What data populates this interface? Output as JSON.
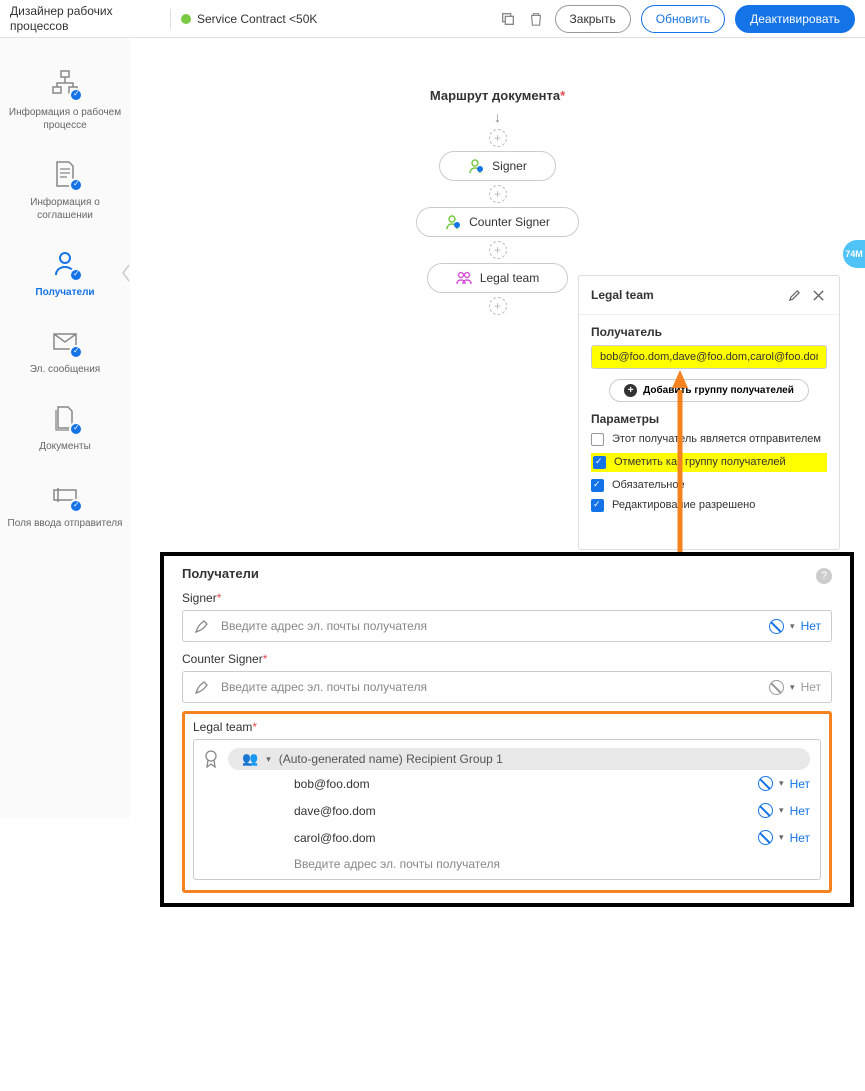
{
  "header": {
    "title": "Дизайнер рабочих процессов",
    "contractName": "Service Contract <50K",
    "closeBtn": "Закрыть",
    "refreshBtn": "Обновить",
    "deactivateBtn": "Деактивировать"
  },
  "sidebar": {
    "items": [
      {
        "label": "Информация о рабочем процессе"
      },
      {
        "label": "Информация о соглашении"
      },
      {
        "label": "Получатели"
      },
      {
        "label": "Эл. сообщения"
      },
      {
        "label": "Документы"
      },
      {
        "label": "Поля ввода отправителя"
      }
    ]
  },
  "canvas": {
    "routeTitle": "Маршрут документа",
    "nodes": [
      "Signer",
      "Counter Signer",
      "Legal team"
    ]
  },
  "panel": {
    "title": "Legal team",
    "recipientLabel": "Получатель",
    "recipientValue": "bob@foo.dom,dave@foo.dom,carol@foo.dom",
    "addGroupBtn": "Добавить группу получателей",
    "paramsLabel": "Параметры",
    "opt1": "Этот получатель является отправителем",
    "opt2": "Отметить как группу получателей",
    "opt3": "Обязательное",
    "opt4": "Редактирование разрешено"
  },
  "badge": "74M",
  "results": {
    "title": "Получатели",
    "fields": [
      {
        "label": "Signer",
        "placeholder": "Введите адрес эл. почты получателя",
        "none": "Нет"
      },
      {
        "label": "Counter Signer",
        "placeholder": "Введите адрес эл. почты получателя",
        "none": "Нет"
      }
    ],
    "legalLabel": "Legal team",
    "groupName": "(Auto-generated name) Recipient Group 1",
    "members": [
      {
        "email": "bob@foo.dom",
        "none": "Нет"
      },
      {
        "email": "dave@foo.dom",
        "none": "Нет"
      },
      {
        "email": "carol@foo.dom",
        "none": "Нет"
      }
    ],
    "memberPlaceholder": "Введите адрес эл. почты получателя"
  }
}
